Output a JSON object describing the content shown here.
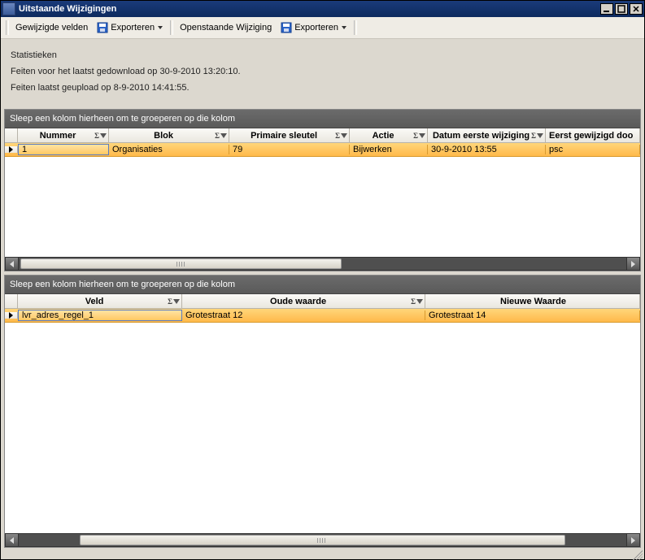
{
  "window": {
    "title": "Uitstaande Wijzigingen"
  },
  "toolbar": {
    "label1": "Gewijzigde velden",
    "export1": "Exporteren",
    "label2": "Openstaande Wijziging",
    "export2": "Exporteren"
  },
  "stats": {
    "heading": "Statistieken",
    "line1": "Feiten voor het laatst gedownload op 30-9-2010 13:20:10.",
    "line2": "Feiten laatst geupload op 8-9-2010 14:41:55."
  },
  "group_hint": "Sleep een kolom hierheen om te groeperen op die kolom",
  "grid1": {
    "columns": [
      "Nummer",
      "Blok",
      "Primaire sleutel",
      "Actie",
      "Datum eerste wijziging",
      "Eerst gewijzigd doo"
    ],
    "row": {
      "nummer": "1",
      "blok": "Organisaties",
      "primaire_sleutel": "79",
      "actie": "Bijwerken",
      "datum_eerste": "30-9-2010 13:55",
      "eerst_gewijzigd": "psc"
    }
  },
  "grid2": {
    "columns": [
      "Veld",
      "Oude waarde",
      "Nieuwe Waarde"
    ],
    "row": {
      "veld": "lvr_adres_regel_1",
      "oude": "Grotestraat 12",
      "nieuwe": "Grotestraat 14"
    }
  }
}
